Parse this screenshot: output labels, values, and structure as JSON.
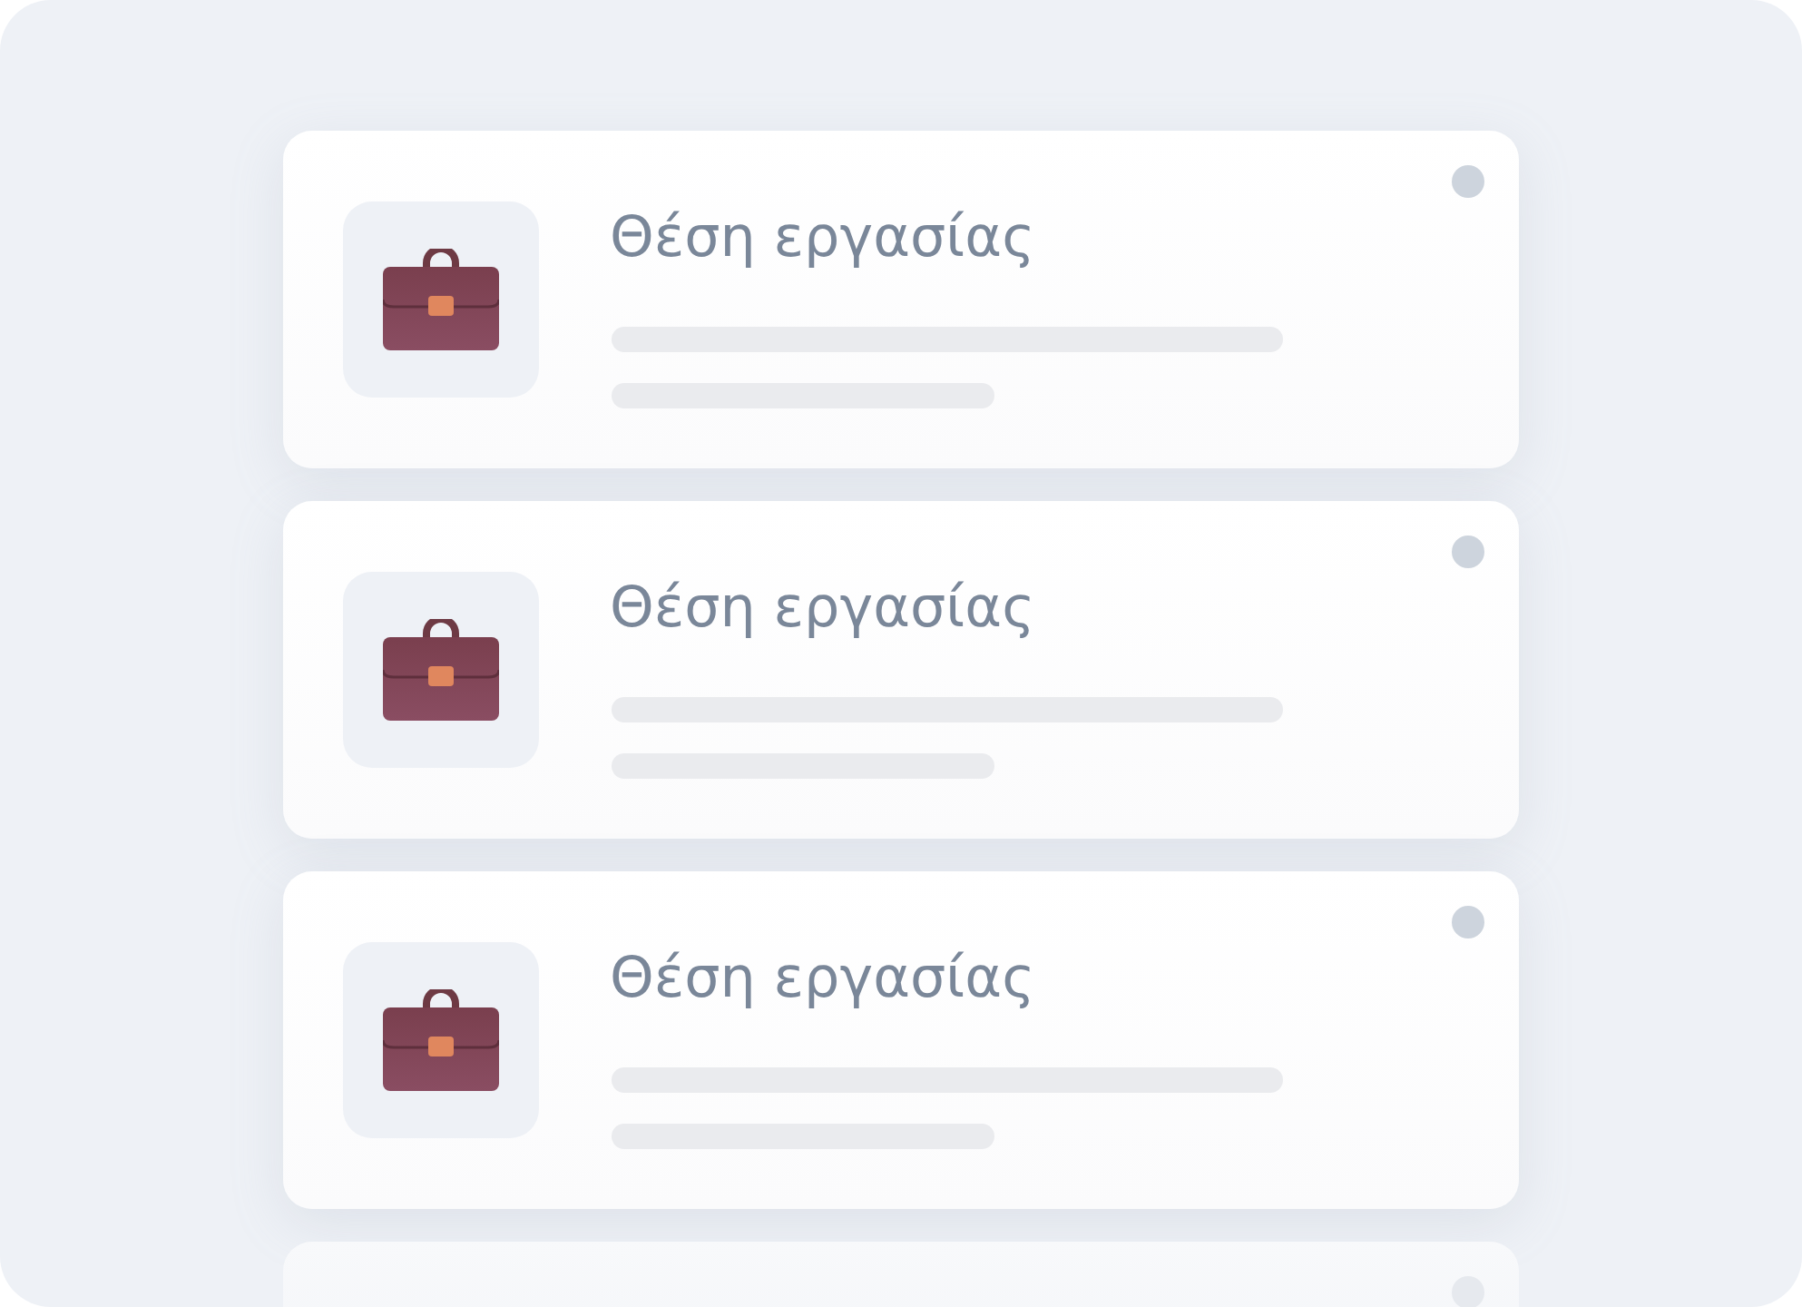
{
  "cards": [
    {
      "title": "Θέση εργασίας"
    },
    {
      "title": "Θέση εργασίας"
    },
    {
      "title": "Θέση εργασίας"
    }
  ]
}
